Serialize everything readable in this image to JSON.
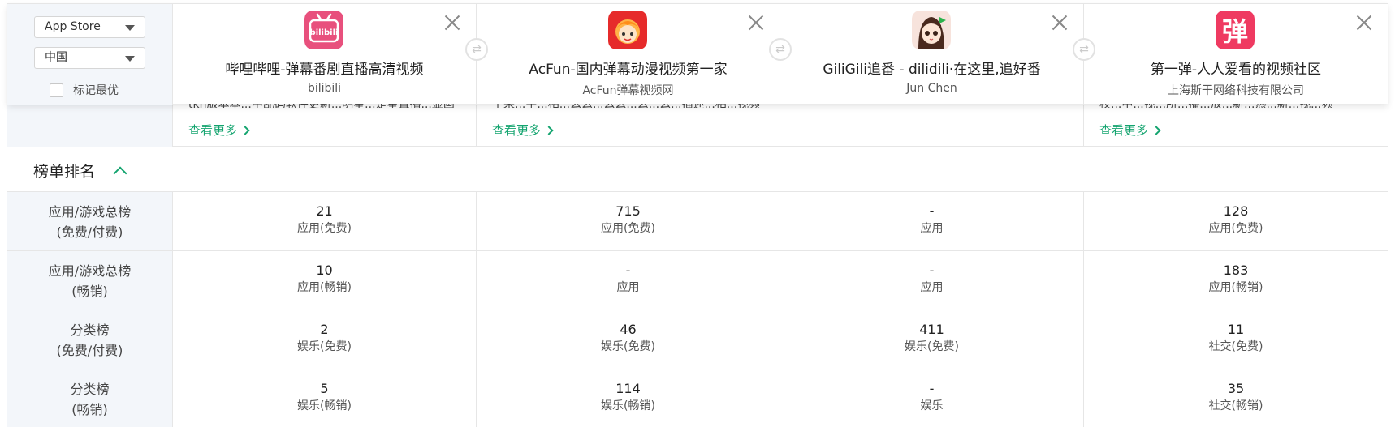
{
  "filters": {
    "store": "App Store",
    "region": "中国",
    "best_label": "标记最优"
  },
  "apps": [
    {
      "name": "哔哩哔哩-弹幕番剧直播高清视频",
      "developer": "bilibili",
      "icon": "bilibili-icon",
      "icon_text": "bilibili",
      "color": "#e8507d",
      "desc": "tkn版本本...中乱码软件更新...明星...是星直播...显画",
      "more": "查看更多"
    },
    {
      "name": "AcFun-国内弹幕动漫视频第一家",
      "developer": "AcFun弹幕视频网",
      "icon": "acfun-icon",
      "icon_text": "",
      "color": "#e62b2b",
      "desc": "十来...字...相...么么...么么...么...么...描述...相...视频",
      "more": "查看更多"
    },
    {
      "name": "GiliGili追番 - dilidili·在这里,追好番",
      "developer": "Jun Chen",
      "icon": "giligili-icon",
      "icon_text": "",
      "color": "#f4d9cf",
      "desc": "",
      "more": ""
    },
    {
      "name": "第一弹-人人爱看的视频社区",
      "developer": "上海斯干网络科技有限公司",
      "icon": "diyidan-icon",
      "icon_text": "弹",
      "color": "#ef3a61",
      "desc": "校...中...视...所...播...放...新...热...新...视...频",
      "more": "查看更多"
    }
  ],
  "section": {
    "title": "榜单排名"
  },
  "rank_rows": [
    {
      "label1": "应用/游戏总榜",
      "label2": "(免费/付费)",
      "cells": [
        {
          "v": "21",
          "s": "应用(免费)"
        },
        {
          "v": "715",
          "s": "应用(免费)"
        },
        {
          "v": "-",
          "s": "应用"
        },
        {
          "v": "128",
          "s": "应用(免费)"
        }
      ]
    },
    {
      "label1": "应用/游戏总榜",
      "label2": "(畅销)",
      "cells": [
        {
          "v": "10",
          "s": "应用(畅销)"
        },
        {
          "v": "-",
          "s": "应用"
        },
        {
          "v": "-",
          "s": "应用"
        },
        {
          "v": "183",
          "s": "应用(畅销)"
        }
      ]
    },
    {
      "label1": "分类榜",
      "label2": "(免费/付费)",
      "cells": [
        {
          "v": "2",
          "s": "娱乐(免费)"
        },
        {
          "v": "46",
          "s": "娱乐(免费)"
        },
        {
          "v": "411",
          "s": "娱乐(免费)"
        },
        {
          "v": "11",
          "s": "社交(免费)"
        }
      ]
    },
    {
      "label1": "分类榜",
      "label2": "(畅销)",
      "cells": [
        {
          "v": "5",
          "s": "娱乐(畅销)"
        },
        {
          "v": "114",
          "s": "娱乐(畅销)"
        },
        {
          "v": "-",
          "s": "娱乐"
        },
        {
          "v": "35",
          "s": "社交(畅销)"
        }
      ]
    }
  ]
}
